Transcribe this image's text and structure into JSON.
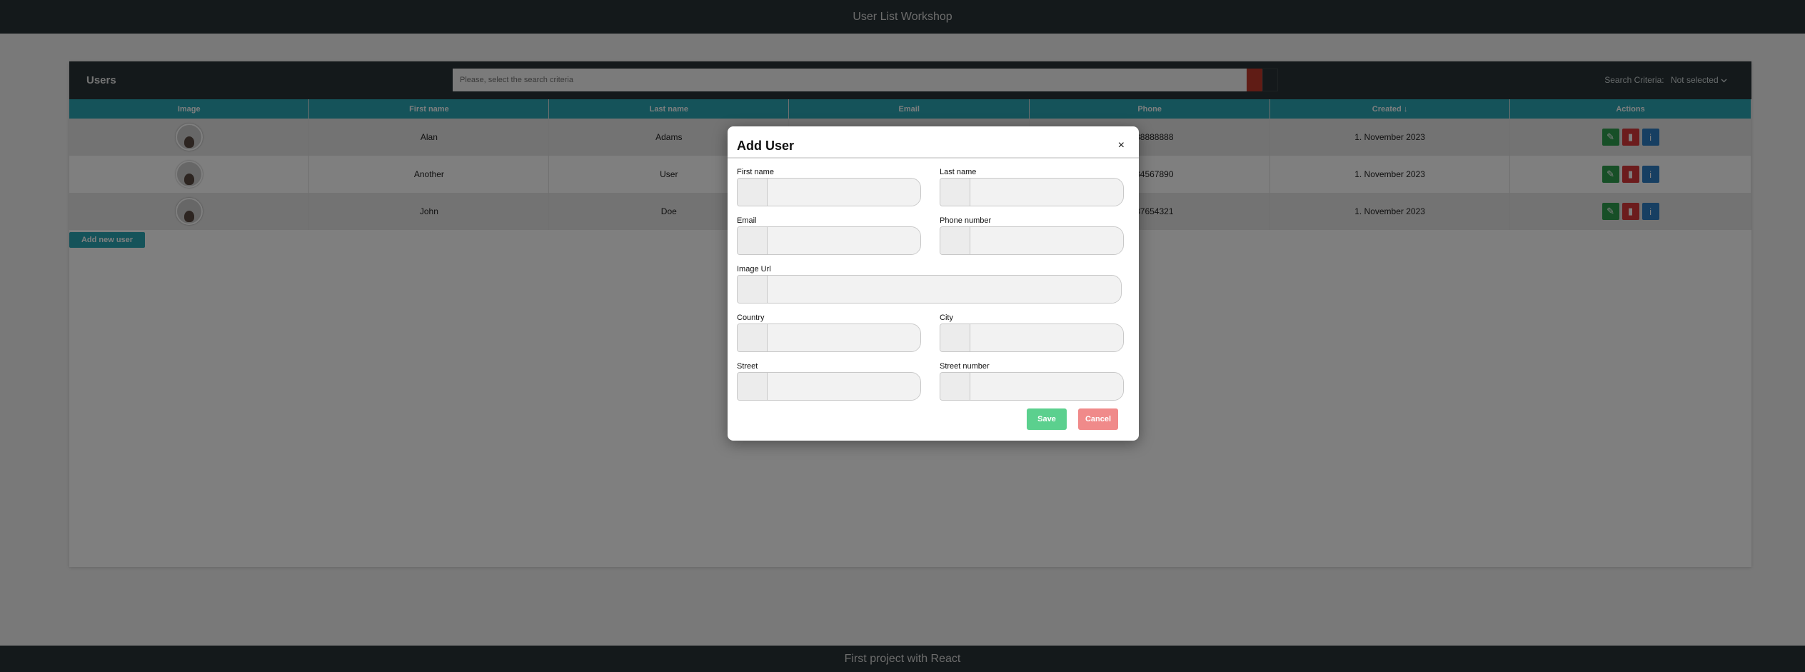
{
  "app": {
    "header_title": "User List Workshop",
    "footer_text": "First project with React"
  },
  "users_panel": {
    "title": "Users",
    "search_placeholder": "Please, select the search criteria",
    "criteria_label": "Search Criteria:",
    "criteria_value": "Not selected",
    "add_button": "Add new user",
    "columns": [
      "Image",
      "First name",
      "Last name",
      "Email",
      "Phone",
      "Created ↓",
      "Actions"
    ],
    "rows": [
      {
        "first": "Alan",
        "last": "Adams",
        "email": "",
        "phone": "0888888888",
        "created": "1. November 2023"
      },
      {
        "first": "Another",
        "last": "User",
        "email": "",
        "phone": "1234567890",
        "created": "1. November 2023"
      },
      {
        "first": "John",
        "last": "Doe",
        "email": "",
        "phone": "0987654321",
        "created": "1. November 2023"
      }
    ]
  },
  "modal": {
    "title": "Add User",
    "close": "×",
    "fields": {
      "first_name": "First name",
      "last_name": "Last name",
      "email": "Email",
      "phone": "Phone number",
      "image_url": "Image Url",
      "country": "Country",
      "city": "City",
      "street": "Street",
      "street_number": "Street number"
    },
    "save": "Save",
    "cancel": "Cancel"
  },
  "colors": {
    "header_bg": "#293336",
    "table_header": "#2ba7b5",
    "save": "#5bd08e",
    "cancel": "#f08a8a",
    "edit": "#2e9e4f",
    "delete": "#d9393a",
    "info": "#2f7fc4"
  },
  "icons": {
    "edit": "pencil-icon",
    "delete": "trash-icon",
    "info": "info-icon",
    "close": "close-icon",
    "chevron": "chevron-down-icon"
  }
}
